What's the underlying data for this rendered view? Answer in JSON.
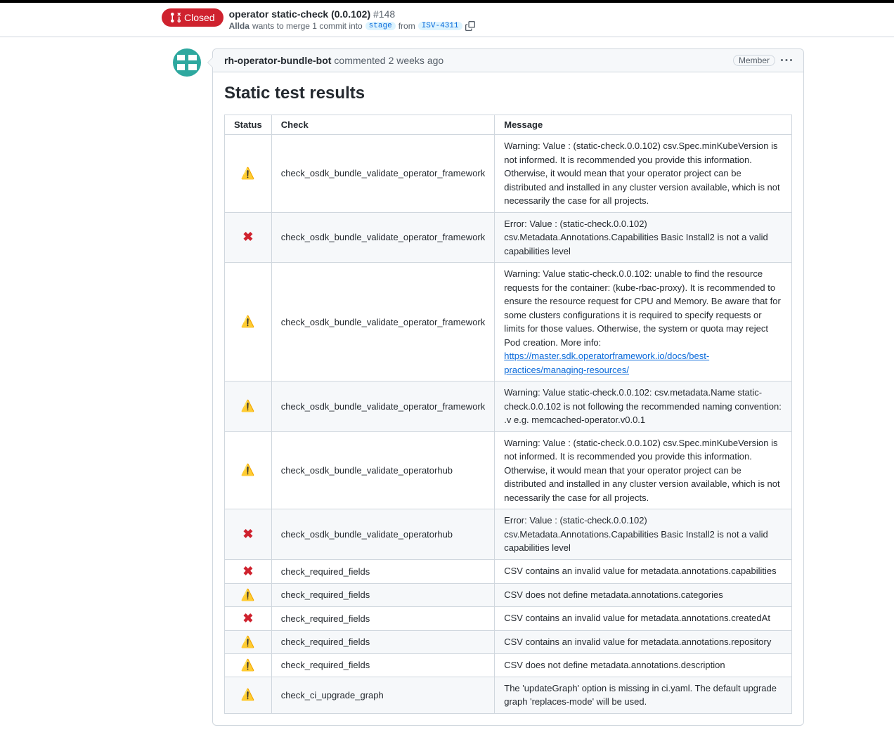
{
  "header": {
    "state": "Closed",
    "title": "operator static-check (0.0.102)",
    "number": "#148",
    "author": "Allda",
    "merge_text_1": "wants to merge 1 commit into",
    "target_branch": "stage",
    "merge_text_2": "from",
    "source_branch": "ISV-4311"
  },
  "comment": {
    "author": "rh-operator-bundle-bot",
    "action": "commented",
    "time": "2 weeks ago",
    "badge": "Member",
    "heading": "Static test results",
    "table": {
      "headers": {
        "status": "Status",
        "check": "Check",
        "message": "Message"
      },
      "rows": [
        {
          "status": "warn",
          "check": "check_osdk_bundle_validate_operator_framework",
          "message": "Warning: Value : (static-check.0.0.102) csv.Spec.minKubeVersion is not informed. It is recommended you provide this information. Otherwise, it would mean that your operator project can be distributed and installed in any cluster version available, which is not necessarily the case for all projects.",
          "link": null
        },
        {
          "status": "error",
          "check": "check_osdk_bundle_validate_operator_framework",
          "message": "Error: Value : (static-check.0.0.102) csv.Metadata.Annotations.Capabilities Basic Install2 is not a valid capabilities level",
          "link": null
        },
        {
          "status": "warn",
          "check": "check_osdk_bundle_validate_operator_framework",
          "message": "Warning: Value static-check.0.0.102: unable to find the resource requests for the container: (kube-rbac-proxy). It is recommended to ensure the resource request for CPU and Memory. Be aware that for some clusters configurations it is required to specify requests or limits for those values. Otherwise, the system or quota may reject Pod creation. More info: ",
          "link": "https://master.sdk.operatorframework.io/docs/best-practices/managing-resources/"
        },
        {
          "status": "warn",
          "check": "check_osdk_bundle_validate_operator_framework",
          "message": "Warning: Value static-check.0.0.102: csv.metadata.Name static-check.0.0.102 is not following the recommended naming convention: .v e.g. memcached-operator.v0.0.1",
          "link": null
        },
        {
          "status": "warn",
          "check": "check_osdk_bundle_validate_operatorhub",
          "message": "Warning: Value : (static-check.0.0.102) csv.Spec.minKubeVersion is not informed. It is recommended you provide this information. Otherwise, it would mean that your operator project can be distributed and installed in any cluster version available, which is not necessarily the case for all projects.",
          "link": null
        },
        {
          "status": "error",
          "check": "check_osdk_bundle_validate_operatorhub",
          "message": "Error: Value : (static-check.0.0.102) csv.Metadata.Annotations.Capabilities Basic Install2 is not a valid capabilities level",
          "link": null
        },
        {
          "status": "error",
          "check": "check_required_fields",
          "message": "CSV contains an invalid value for metadata.annotations.capabilities",
          "link": null
        },
        {
          "status": "warn",
          "check": "check_required_fields",
          "message": "CSV does not define metadata.annotations.categories",
          "link": null
        },
        {
          "status": "error",
          "check": "check_required_fields",
          "message": "CSV contains an invalid value for metadata.annotations.createdAt",
          "link": null
        },
        {
          "status": "warn",
          "check": "check_required_fields",
          "message": "CSV contains an invalid value for metadata.annotations.repository",
          "link": null
        },
        {
          "status": "warn",
          "check": "check_required_fields",
          "message": "CSV does not define metadata.annotations.description",
          "link": null
        },
        {
          "status": "warn",
          "check": "check_ci_upgrade_graph",
          "message": "The 'updateGraph' option is missing in ci.yaml. The default upgrade graph 'replaces-mode' will be used.",
          "link": null
        }
      ]
    }
  }
}
